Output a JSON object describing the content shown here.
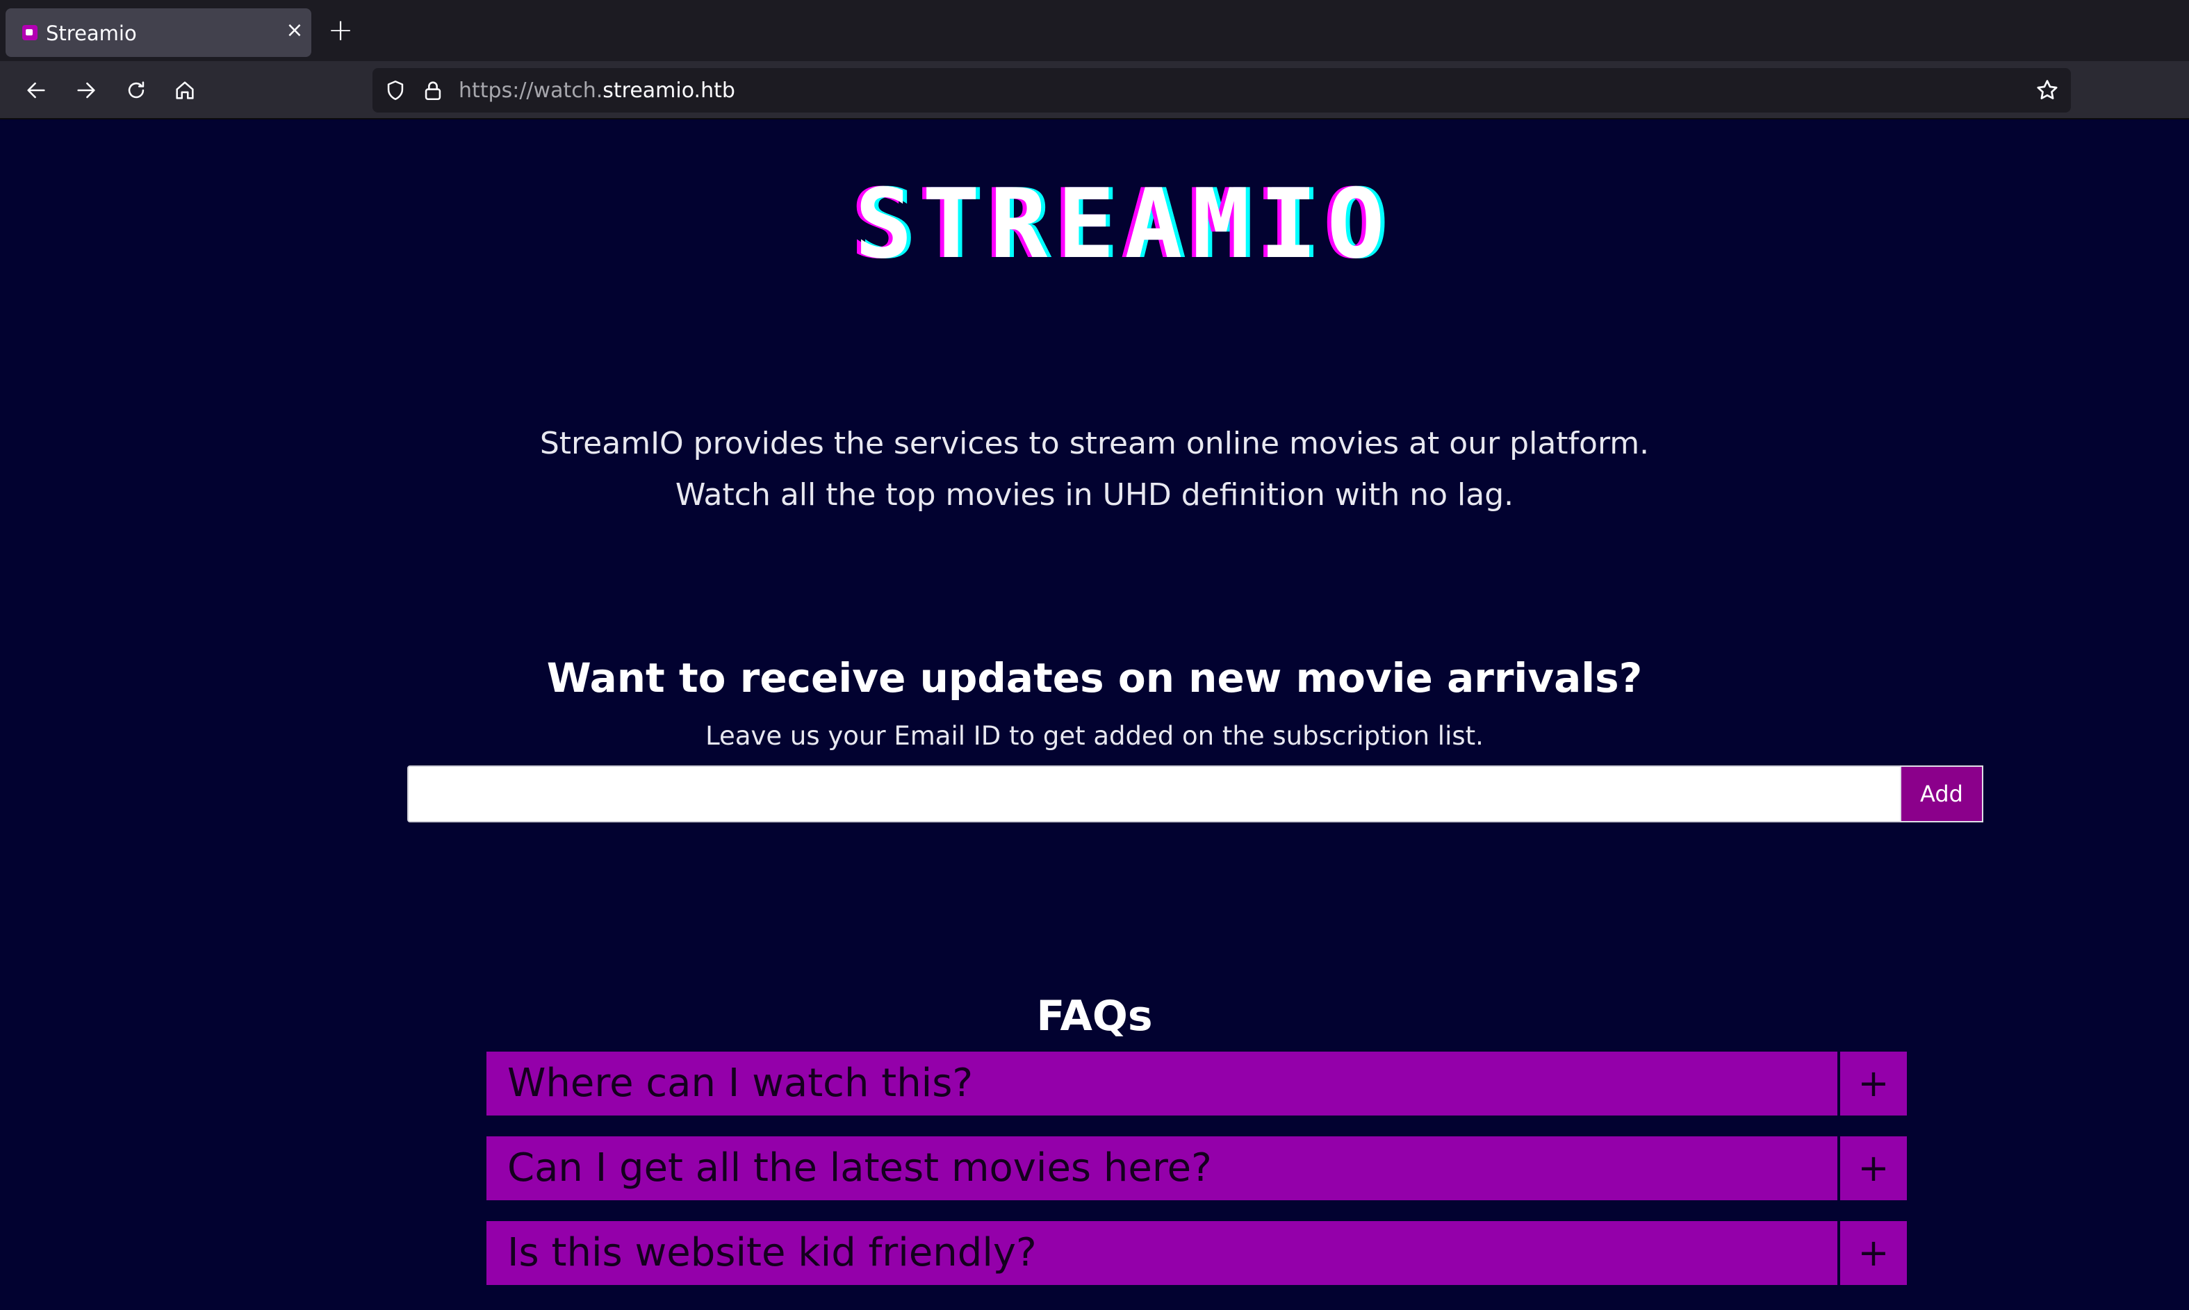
{
  "browser": {
    "tab": {
      "title": "Streamio",
      "close": "×"
    },
    "new_tab": "+",
    "url": {
      "scheme_sub": "https://watch.",
      "host": "streamio.htb"
    }
  },
  "page": {
    "logo": "STREAMIO",
    "intro_lines": [
      "StreamIO provides the services to stream online movies at our platform.",
      "Watch all the top movies in UHD definition with no lag."
    ],
    "subscribe": {
      "title": "Want to receive updates on new movie arrivals?",
      "subtitle": "Leave us your Email ID to get added on the subscription list.",
      "input_value": "",
      "button_label": "Add"
    },
    "faq": {
      "title": "FAQs",
      "items": [
        {
          "question": "Where can I watch this?",
          "toggle": "+"
        },
        {
          "question": "Can I get all the latest movies here?",
          "toggle": "+"
        },
        {
          "question": "Is this website kid friendly?",
          "toggle": "+"
        }
      ]
    }
  },
  "colors": {
    "page_bg": "#020230",
    "accent": "#9400aa",
    "button": "#8b008b"
  },
  "icons": [
    "back-arrow-icon",
    "forward-arrow-icon",
    "reload-icon",
    "home-icon",
    "shield-icon",
    "lock-icon",
    "bookmark-star-icon"
  ]
}
